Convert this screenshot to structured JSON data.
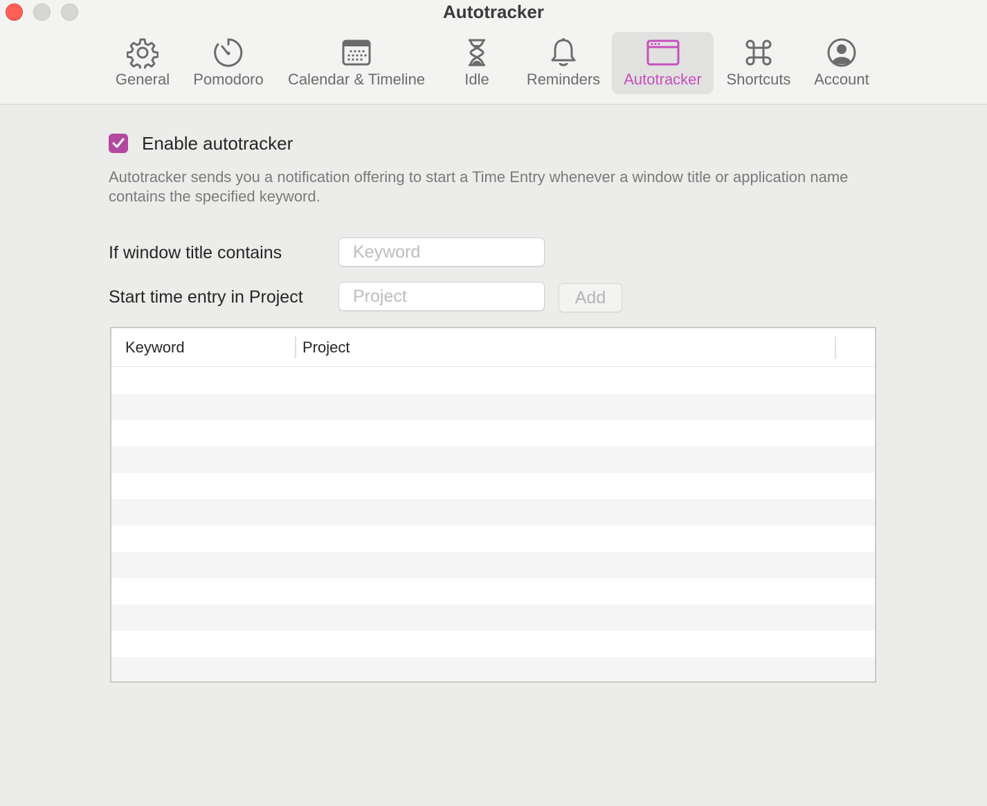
{
  "window": {
    "title": "Autotracker"
  },
  "toolbar": {
    "active_color": "#c64fbd",
    "items": [
      {
        "label": "General",
        "icon": "gear-icon"
      },
      {
        "label": "Pomodoro",
        "icon": "timer-icon"
      },
      {
        "label": "Calendar & Timeline",
        "icon": "calendar-icon"
      },
      {
        "label": "Idle",
        "icon": "hourglass-icon"
      },
      {
        "label": "Reminders",
        "icon": "bell-icon"
      },
      {
        "label": "Autotracker",
        "icon": "window-icon",
        "active": true
      },
      {
        "label": "Shortcuts",
        "icon": "command-icon"
      },
      {
        "label": "Account",
        "icon": "user-circle-icon"
      }
    ]
  },
  "autotracker": {
    "enable_label": "Enable autotracker",
    "enabled": true,
    "checkbox_color": "#b4489f",
    "description": "Autotracker sends you a notification offering to start a Time Entry whenever a window title or application name contains the specified keyword.",
    "keyword_label": "If window title contains",
    "keyword_placeholder": "Keyword",
    "keyword_value": "",
    "project_label": "Start time entry in Project",
    "project_placeholder": "Project",
    "project_value": "",
    "add_label": "Add"
  },
  "rules_table": {
    "columns": [
      "Keyword",
      "Project"
    ],
    "rows": []
  }
}
